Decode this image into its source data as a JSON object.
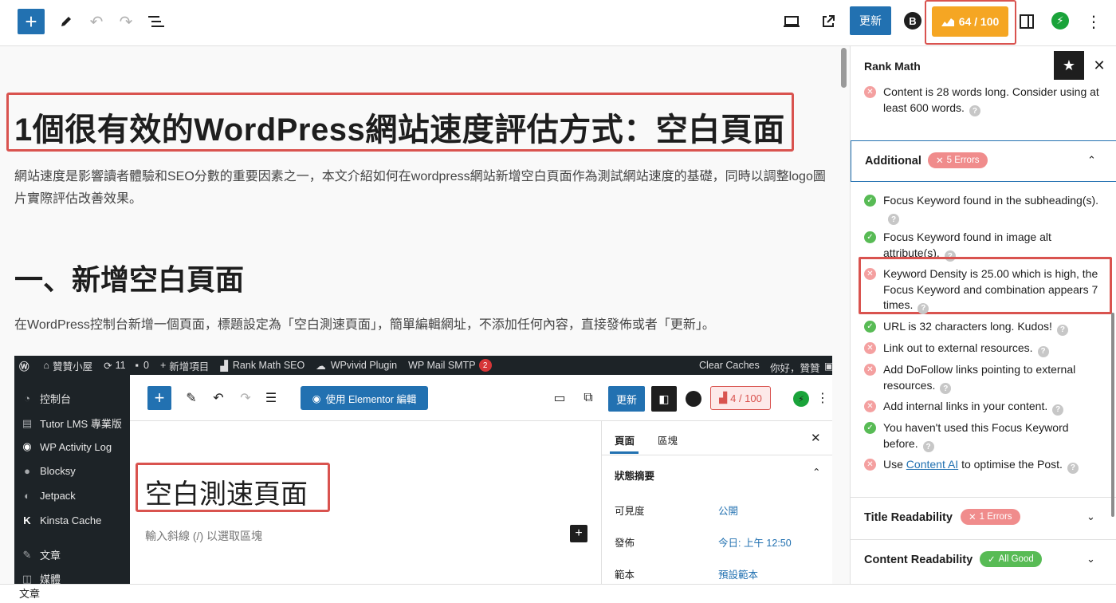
{
  "toolbar": {
    "update_label": "更新",
    "score": "64 / 100",
    "add_icon": "plus-icon",
    "tools_icon": "pencil-icon",
    "undo_icon": "undo-icon",
    "redo_icon": "redo-icon",
    "outline_icon": "list-view-icon",
    "preview_icon": "desktop-preview-icon",
    "view_icon": "external-link-icon",
    "settings_icon": "sidebar-toggle-icon",
    "more_icon": "kebab-menu-icon"
  },
  "post": {
    "title": "1個很有效的WordPress網站速度評估方式：空白頁面",
    "intro": "網站速度是影響讀者體驗和SEO分數的重要因素之一，本文介紹如何在wordpress網站新增空白頁面作為測試網站速度的基礎，同時以調整logo圖片實際評估改善效果。",
    "heading": "一、新增空白頁面",
    "paragraph": "在WordPress控制台新增一個頁面，標題設定為「空白測速頁面」，簡單編輯網址，不添加任何內容，直接發佈或者「更新」。"
  },
  "screenshot": {
    "adminbar": {
      "site": "贊贊小屋",
      "updates": "11",
      "comments": "0",
      "new": "新增項目",
      "rankmath": "Rank Math SEO",
      "wpvivid": "WPvivid Plugin",
      "smtp": "WP Mail SMTP",
      "smtp_count": "2",
      "clear": "Clear Caches",
      "greeting": "你好，贊贊"
    },
    "menu": [
      "控制台",
      "Tutor LMS 專業版",
      "WP Activity Log",
      "Blocksy",
      "Jetpack",
      "Kinsta Cache",
      "文章",
      "媒體"
    ],
    "elementor_label": "使用 Elementor 編輯",
    "update_label": "更新",
    "score": "4 / 100",
    "page_title": "空白測速頁面",
    "placeholder": "輸入斜線 (/) 以選取區塊",
    "panel": {
      "tab_page": "頁面",
      "tab_block": "區塊",
      "summary": "狀態摘要",
      "visibility_label": "可見度",
      "visibility_value": "公開",
      "publish_label": "發佈",
      "publish_value": "今日: 上午 12:50",
      "template_label": "範本",
      "template_value": "預設範本"
    }
  },
  "footer": {
    "label": "文章"
  },
  "rankmath": {
    "title": "Rank Math",
    "top_item": {
      "text": "Content is 28 words long. Consider using at least 600 words.",
      "status": "error"
    },
    "additional": {
      "label": "Additional",
      "badge": "5 Errors",
      "items": [
        {
          "text": "Focus Keyword found in the subheading(s).",
          "status": "ok"
        },
        {
          "text": "Focus Keyword found in image alt attribute(s).",
          "status": "ok"
        },
        {
          "text": "Keyword Density is 25.00 which is high, the Focus Keyword and combination appears 7 times.",
          "status": "error"
        },
        {
          "text": "URL is 32 characters long. Kudos!",
          "status": "ok"
        },
        {
          "text": "Link out to external resources.",
          "status": "error"
        },
        {
          "text": "Add DoFollow links pointing to external resources.",
          "status": "error"
        },
        {
          "text": "Add internal links in your content.",
          "status": "error"
        },
        {
          "text": "You haven't used this Focus Keyword before.",
          "status": "ok"
        },
        {
          "text_pre": "Use ",
          "link": "Content AI",
          "text_post": " to optimise the Post.",
          "status": "error"
        }
      ]
    },
    "title_readability": {
      "label": "Title Readability",
      "badge": "1 Errors"
    },
    "content_readability": {
      "label": "Content Readability",
      "badge": "All Good"
    }
  },
  "colors": {
    "accent": "#2271b1",
    "score": "#f5a623",
    "error": "#f08c8c",
    "ok": "#58bb55",
    "highlight": "#d9534f"
  }
}
